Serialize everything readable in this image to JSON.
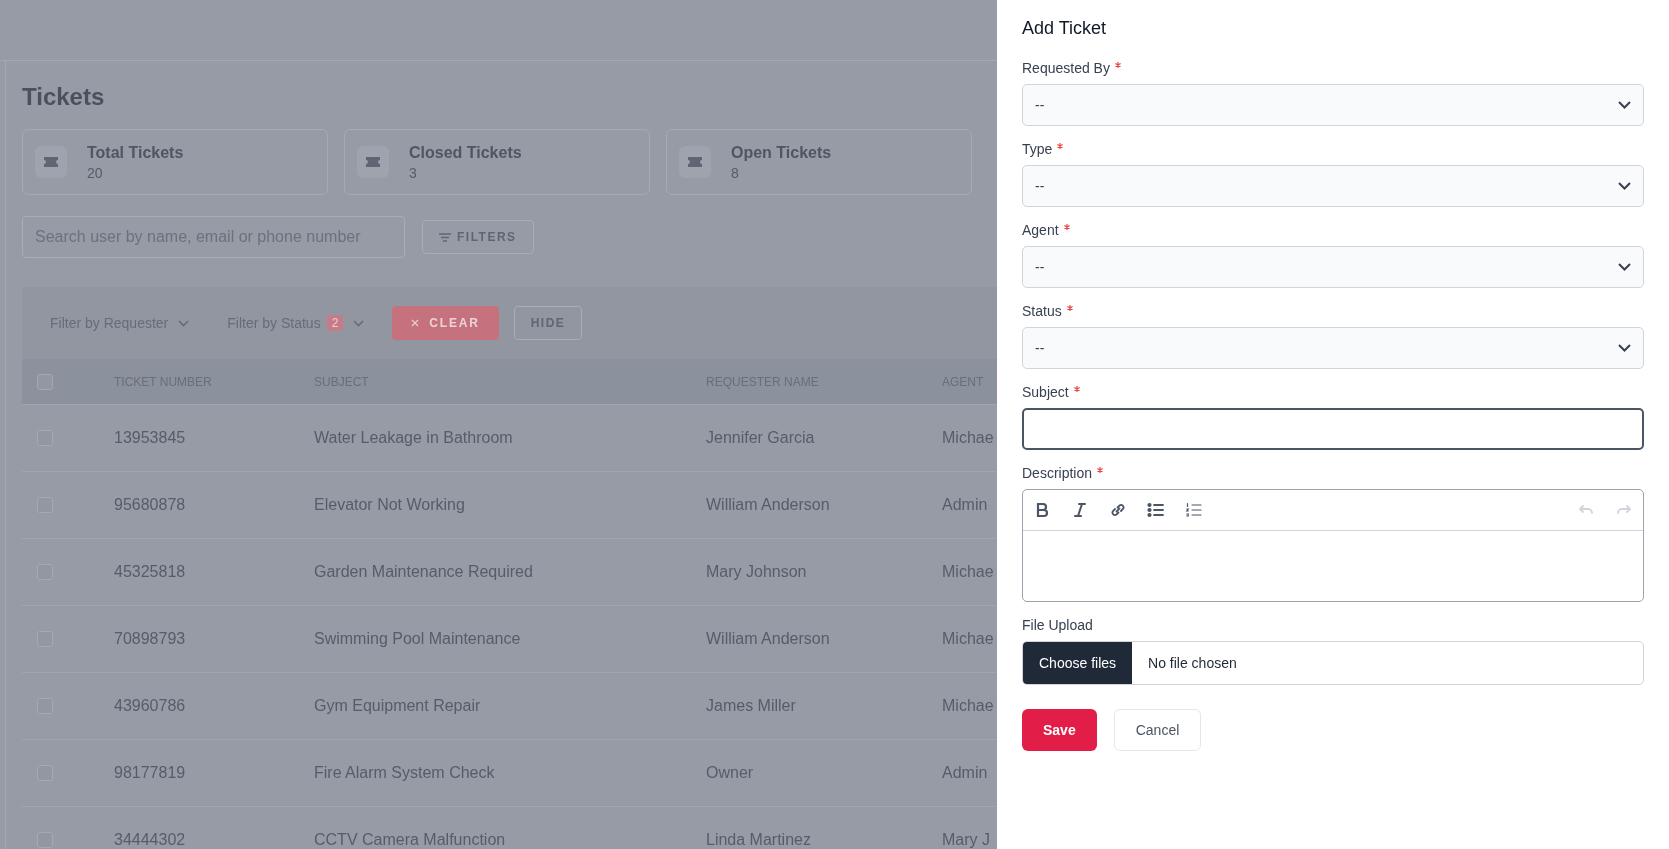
{
  "page": {
    "title": "Tickets",
    "stats": [
      {
        "label": "Total Tickets",
        "value": "20"
      },
      {
        "label": "Closed Tickets",
        "value": "3"
      },
      {
        "label": "Open Tickets",
        "value": "8"
      }
    ],
    "search": {
      "placeholder": "Search user by name, email or phone number"
    },
    "filters_button": "FILTERS",
    "filter_bar": {
      "requester": "Filter by Requester",
      "status": "Filter by Status",
      "status_count": "2",
      "clear": "CLEAR",
      "hide": "HIDE"
    },
    "table": {
      "header_checked": false,
      "columns": [
        "TICKET NUMBER",
        "SUBJECT",
        "REQUESTER NAME",
        "AGENT"
      ],
      "rows": [
        {
          "checked": false,
          "cells": [
            "13953845",
            "Water Leakage in Bathroom",
            "Jennifer Garcia",
            "Michae"
          ]
        },
        {
          "checked": false,
          "cells": [
            "95680878",
            "Elevator Not Working",
            "William Anderson",
            "Admin"
          ]
        },
        {
          "checked": false,
          "cells": [
            "45325818",
            "Garden Maintenance Required",
            "Mary Johnson",
            "Michae"
          ]
        },
        {
          "checked": false,
          "cells": [
            "70898793",
            "Swimming Pool Maintenance",
            "William Anderson",
            "Michae"
          ]
        },
        {
          "checked": false,
          "cells": [
            "43960786",
            "Gym Equipment Repair",
            "James Miller",
            "Michae"
          ]
        },
        {
          "checked": false,
          "cells": [
            "98177819",
            "Fire Alarm System Check",
            "Owner",
            "Admin"
          ]
        },
        {
          "checked": false,
          "cells": [
            "34444302",
            "CCTV Camera Malfunction",
            "Linda Martinez",
            "Mary J"
          ]
        }
      ]
    }
  },
  "panel": {
    "title": "Add Ticket",
    "fields": [
      {
        "kind": "select",
        "label": "Requested By",
        "required": true,
        "value": "--"
      },
      {
        "kind": "select",
        "label": "Type",
        "required": true,
        "value": "--"
      },
      {
        "kind": "select",
        "label": "Agent",
        "required": true,
        "value": "--"
      },
      {
        "kind": "select",
        "label": "Status",
        "required": true,
        "value": "--"
      },
      {
        "kind": "text",
        "label": "Subject",
        "required": true,
        "focused": true
      },
      {
        "kind": "richtext",
        "label": "Description",
        "required": true,
        "toolbar": [
          {
            "kind": "bold",
            "disabled": false
          },
          {
            "kind": "italic",
            "disabled": false
          },
          {
            "kind": "link",
            "disabled": false
          },
          {
            "kind": "bullets",
            "disabled": false
          },
          {
            "kind": "numbers",
            "disabled": false
          },
          {
            "kind": "undo",
            "disabled": true
          },
          {
            "kind": "redo",
            "disabled": true
          }
        ]
      },
      {
        "kind": "file",
        "label": "File Upload",
        "required": false,
        "button": "Choose files",
        "status": "No file chosen"
      }
    ],
    "save": "Save",
    "cancel": "Cancel"
  }
}
